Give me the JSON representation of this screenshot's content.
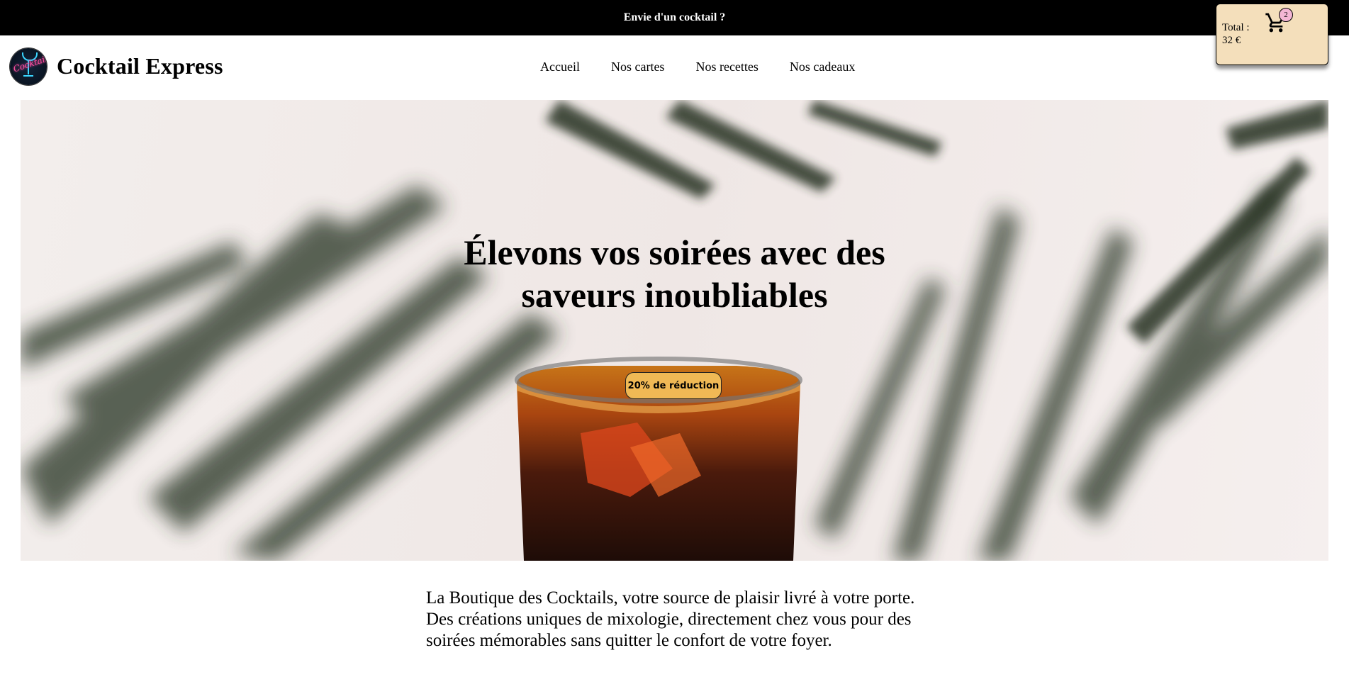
{
  "topbar": {
    "message": "Envie d'un cocktail ?"
  },
  "header": {
    "brand": "Cocktail Express",
    "logo_text": "Cocktails",
    "nav": [
      "Accueil",
      "Nos cartes",
      "Nos recettes",
      "Nos cadeaux"
    ]
  },
  "cart": {
    "total_label": "Total :",
    "total_value": "32 €",
    "count": "2",
    "icon": "cart-icon"
  },
  "hero": {
    "title_line1": "Élevons vos soirées avec des",
    "title_line2": "saveurs inoubliables",
    "badge": "20% de réduction"
  },
  "intro": {
    "text": "La Boutique des Cocktails, votre source de plaisir livré à votre porte. Des créations uniques de mixologie, directement chez vous pour des soirées mémorables sans quitter le confort de votre foyer."
  },
  "colors": {
    "topbar_bg": "#000000",
    "cart_bg": "#f4dfbb",
    "badge_bg": "#f0b955",
    "count_bg": "#f3b6d4"
  }
}
